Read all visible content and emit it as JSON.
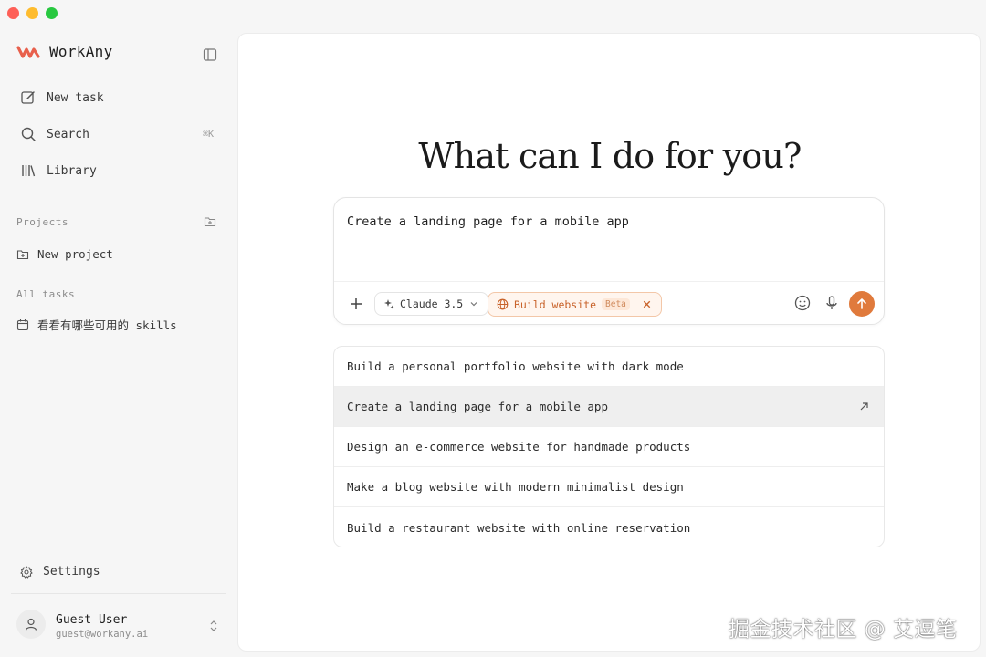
{
  "app": {
    "name": "WorkAny",
    "accent": "#e07a3c"
  },
  "sidebar": {
    "nav": [
      {
        "label": "New task",
        "icon": "edit-icon"
      },
      {
        "label": "Search",
        "icon": "search-icon",
        "shortcut": "⌘K"
      },
      {
        "label": "Library",
        "icon": "library-icon"
      }
    ],
    "projects_label": "Projects",
    "new_project_label": "New project",
    "all_tasks_label": "All tasks",
    "tasks": [
      {
        "label": "看看有哪些可用的 skills",
        "icon": "calendar-icon"
      }
    ],
    "settings_label": "Settings",
    "user": {
      "name": "Guest User",
      "email": "guest@workany.ai"
    }
  },
  "main": {
    "headline": "What can I do for you?",
    "composer": {
      "value": "Create a landing page for a mobile app",
      "model_label": "Claude 3.5",
      "mode_label": "Build website",
      "mode_badge": "Beta"
    },
    "suggestions": [
      "Build a personal portfolio website with dark mode",
      "Create a landing page for a mobile app",
      "Design an e-commerce website for handmade products",
      "Make a blog website with modern minimalist design",
      "Build a restaurant website with online reservation"
    ],
    "active_suggestion_index": 1
  },
  "watermark": "掘金技术社区 @ 艾逗笔"
}
